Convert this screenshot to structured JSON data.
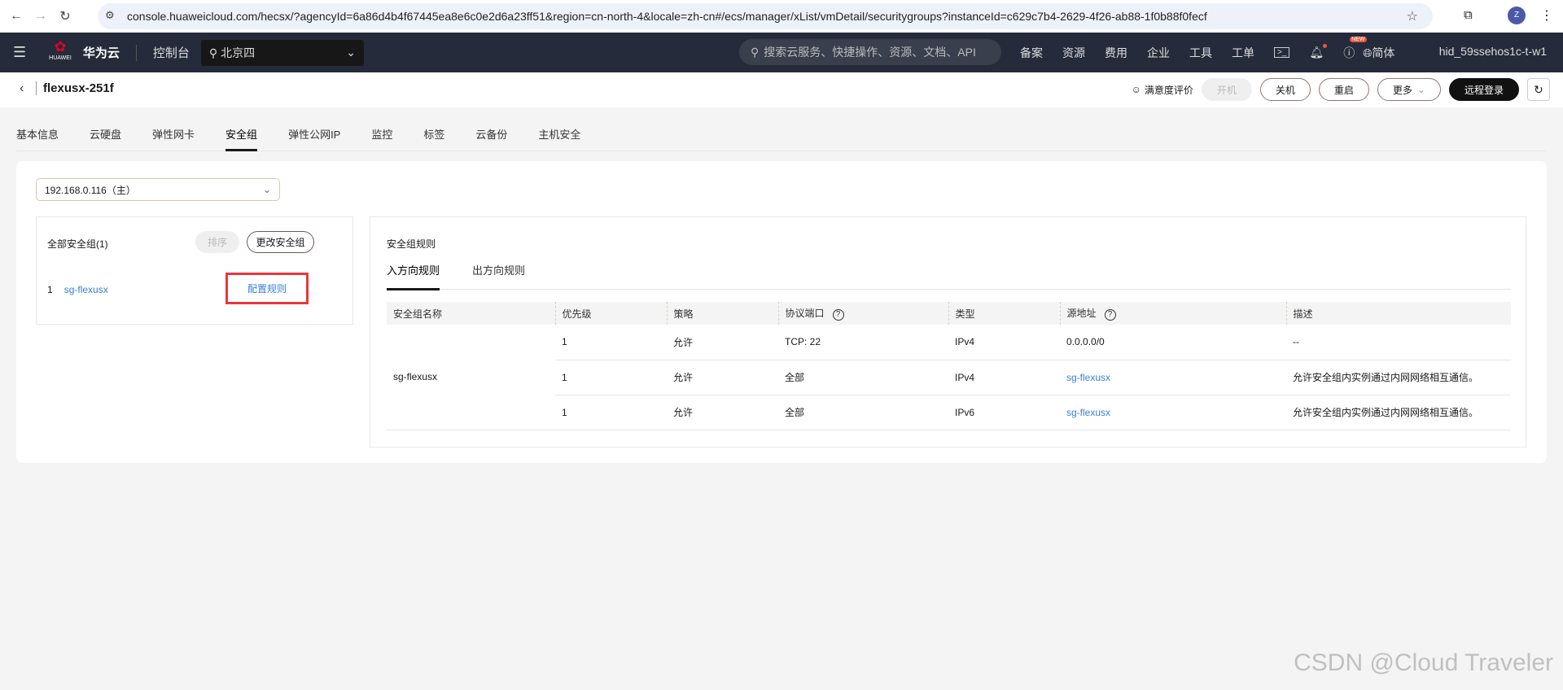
{
  "browser": {
    "url": "console.huaweicloud.com/hecsx/?agencyId=6a86d4b4f67445ea8e6c0e2d6a23ff51&region=cn-north-4&locale=zh-cn#/ecs/manager/xList/vmDetail/securitygroups?instanceId=c629c7b4-2629-4f26-ab88-1f0b88f0fecf",
    "profile": "Z"
  },
  "header": {
    "logo_text": "HUAWEI",
    "brand": "华为云",
    "console": "控制台",
    "region": "北京四",
    "search_placeholder": "搜索云服务、快捷操作、资源、文档、API",
    "links": [
      "备案",
      "资源",
      "费用",
      "企业",
      "工具",
      "工单"
    ],
    "new_badge": "NEW",
    "lang": "简体",
    "user": "hid_59ssehos1c-t-w1"
  },
  "title": {
    "name": "flexusx-251f",
    "satisfaction": "满意度评价",
    "buttons": {
      "start": "开机",
      "shutdown": "关机",
      "restart": "重启",
      "more": "更多",
      "remote_login": "远程登录"
    }
  },
  "tabs": [
    "基本信息",
    "云硬盘",
    "弹性网卡",
    "安全组",
    "弹性公网IP",
    "监控",
    "标签",
    "云备份",
    "主机安全"
  ],
  "active_tab": "安全组",
  "nic_select": "192.168.0.116（主）",
  "left": {
    "title": "全部安全组(1)",
    "sort": "排序",
    "change": "更改安全组",
    "groups": [
      {
        "index": "1",
        "name": "sg-flexusx",
        "action": "配置规则"
      }
    ]
  },
  "rules": {
    "title": "安全组规则",
    "tabs": [
      "入方向规则",
      "出方向规则"
    ],
    "columns": [
      "安全组名称",
      "优先级",
      "策略",
      "协议端口",
      "类型",
      "源地址",
      "描述"
    ],
    "group_name": "sg-flexusx",
    "rows": [
      {
        "priority": "1",
        "policy": "允许",
        "port": "TCP: 22",
        "type": "IPv4",
        "source": "0.0.0.0/0",
        "source_link": false,
        "desc": "--"
      },
      {
        "priority": "1",
        "policy": "允许",
        "port": "全部",
        "type": "IPv4",
        "source": "sg-flexusx",
        "source_link": true,
        "desc": "允许安全组内实例通过内网网络相互通信。"
      },
      {
        "priority": "1",
        "policy": "允许",
        "port": "全部",
        "type": "IPv6",
        "source": "sg-flexusx",
        "source_link": true,
        "desc": "允许安全组内实例通过内网网络相互通信。"
      }
    ]
  },
  "watermark": "CSDN @Cloud Traveler"
}
